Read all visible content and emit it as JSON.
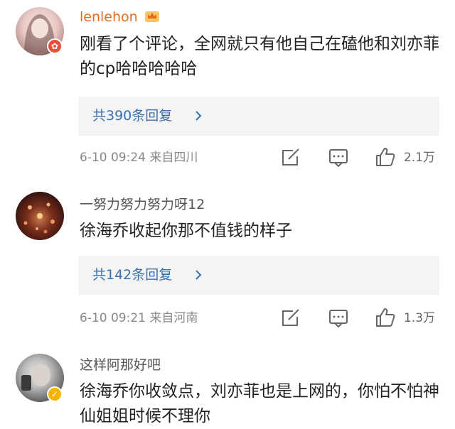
{
  "comments": [
    {
      "username": "lenlehon",
      "text": "刚看了个评论，全网就只有他自己在磕他和刘亦菲的cp哈哈哈哈哈",
      "reply_label": "共390条回复",
      "time": "6-10 09:24",
      "location": "来自四川",
      "likes": "2.1万"
    },
    {
      "username": "一努力努力努力呀12",
      "text": "徐海乔收起你那不值钱的样子",
      "reply_label": "共142条回复",
      "time": "6-10 09:21",
      "location": "来自河南",
      "likes": "1.3万"
    },
    {
      "username": "这样阿那好吧",
      "text": "徐海乔你收敛点，刘亦菲也是上网的，你怕不怕神仙姐姐时候不理你"
    }
  ],
  "colors": {
    "vip_name": "#e8691c",
    "reply_link": "#3a6fb0",
    "meta": "#888888"
  },
  "icons": [
    "crown-icon",
    "verified-badge-icon",
    "share-icon",
    "comment-icon",
    "like-icon",
    "chevron-right-icon"
  ]
}
